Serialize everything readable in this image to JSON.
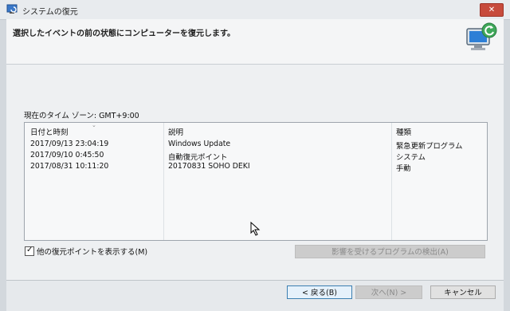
{
  "window": {
    "title": "システムの復元",
    "close_symbol": "✕"
  },
  "header": {
    "instruction": "選択したイベントの前の状態にコンピューターを復元します。"
  },
  "timezone": {
    "label": "現在のタイム ゾーン: GMT+9:00"
  },
  "table": {
    "columns": [
      "日付と時刻",
      "説明",
      "種類"
    ],
    "rows": [
      {
        "datetime": "2017/09/13 23:04:19",
        "description": "Windows Update",
        "type": "緊急更新プログラム"
      },
      {
        "datetime": "2017/09/10 0:45:50",
        "description": "自動復元ポイント",
        "type": "システム"
      },
      {
        "datetime": "2017/08/31 10:11:20",
        "description": "20170831 SOHO DEKI",
        "type": "手動"
      }
    ]
  },
  "options": {
    "show_more_label": "他の復元ポイントを表示する(M)",
    "show_more_checked": true,
    "check_mark": "✓"
  },
  "buttons": {
    "scan": "影響を受けるプログラムの検出(A)",
    "back": "< 戻る(B)",
    "next": "次へ(N) >",
    "cancel": "キャンセル"
  },
  "colors": {
    "close": "#c74b3c",
    "primary_border": "#3c7fb1"
  }
}
